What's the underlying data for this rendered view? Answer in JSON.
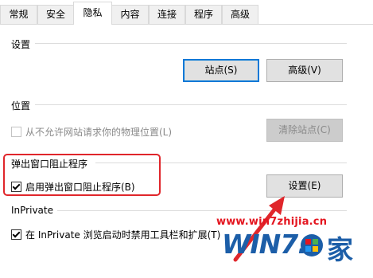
{
  "tabs": [
    {
      "label": "常规"
    },
    {
      "label": "安全"
    },
    {
      "label": "隐私",
      "active": true
    },
    {
      "label": "内容"
    },
    {
      "label": "连接"
    },
    {
      "label": "程序"
    },
    {
      "label": "高级"
    }
  ],
  "settings_group": {
    "header": "设置",
    "sites_button": "站点(S)",
    "advanced_button": "高级(V)"
  },
  "location_group": {
    "header": "位置",
    "checkbox_label": "从不允许网站请求你的物理位置(L)",
    "checkbox_checked": false,
    "checkbox_disabled": true,
    "clear_sites_button": "清除站点(C)"
  },
  "popup_blocker_group": {
    "header": "弹出窗口阻止程序",
    "checkbox_label": "启用弹出窗口阻止程序(B)",
    "checkbox_checked": true,
    "settings_button": "设置(E)"
  },
  "inprivate_group": {
    "header": "InPrivate",
    "checkbox_label": "在 InPrivate 浏览启动时禁用工具栏和扩展(T)",
    "checkbox_checked": true
  },
  "watermark": {
    "url": "www.win7zhijia.cn",
    "logo_text_left": "WIN7.",
    "logo_text_right": "家"
  },
  "colors": {
    "highlight": "#e0262b",
    "accent": "#0078d7",
    "watermark_red": "#e4151f",
    "watermark_blue": "#1c5ea8"
  },
  "icons": {
    "watermark_logo": "windows-flag-icon",
    "annotation": "red-arrow-icon"
  }
}
